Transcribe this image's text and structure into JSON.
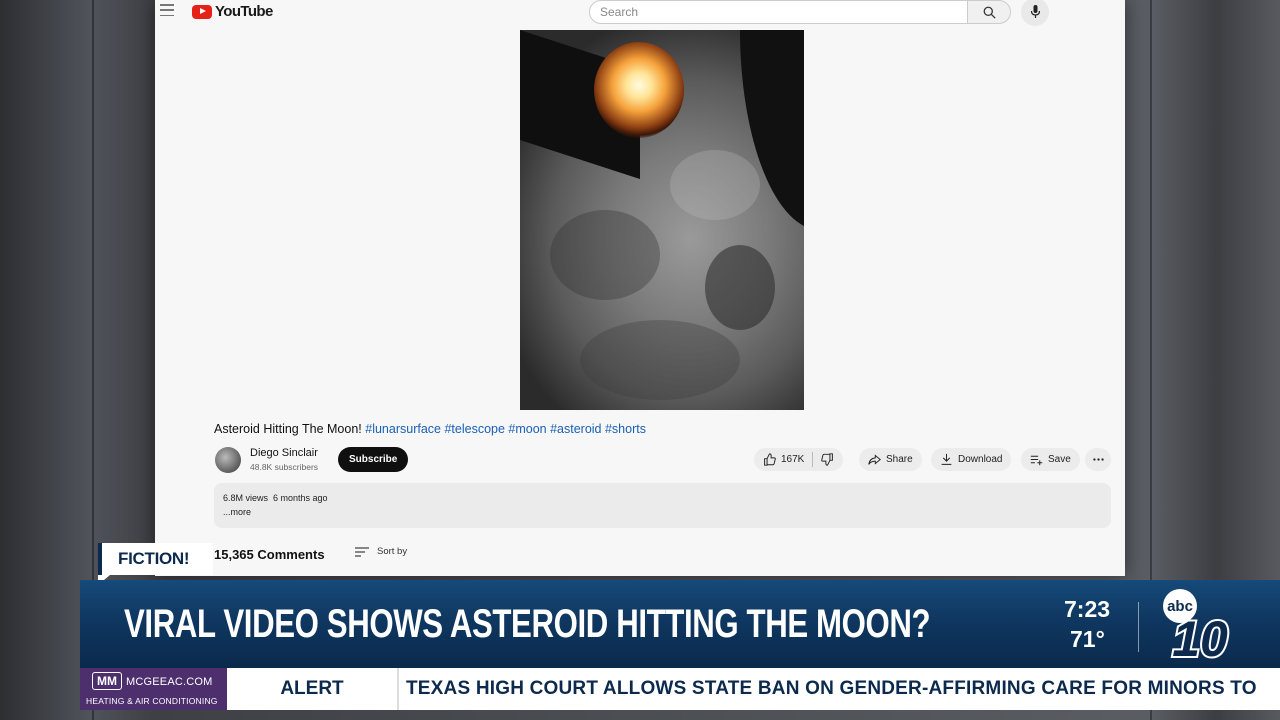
{
  "youtube": {
    "logo_text": "YouTube",
    "search_placeholder": "Search",
    "video_title": "Asteroid Hitting The Moon!",
    "video_tags": "#lunarsurface #telescope #moon #asteroid #shorts",
    "channel_name": "Diego Sinclair",
    "subscriber_count": "48.8K subscribers",
    "subscribe_label": "Subscribe",
    "like_count": "167K",
    "share_label": "Share",
    "download_label": "Download",
    "save_label": "Save",
    "views": "6.8M views",
    "age": "6 months ago",
    "more_label": "...more",
    "comments_count": "15,365 Comments",
    "sort_label": "Sort by"
  },
  "broadcast": {
    "fiction_label": "FICTION!",
    "headline": "VIRAL VIDEO SHOWS ASTEROID HITTING THE MOON?",
    "time": "7:23",
    "temperature": "71°",
    "sponsor_mark": "MM",
    "sponsor_site": "MCGEEAC.COM",
    "sponsor_tagline": "HEATING & AIR CONDITIONING",
    "alert_label": "ALERT",
    "ticker": "TEXAS HIGH COURT ALLOWS STATE BAN ON GENDER-AFFIRMING CARE FOR MINORS TO",
    "station_network": "abc",
    "station_number": "10"
  },
  "colors": {
    "navy": "#0c2a4d",
    "youtube_red": "#e62117",
    "link_blue": "#1a5fb4",
    "sponsor_purple": "#4d2f6e"
  }
}
